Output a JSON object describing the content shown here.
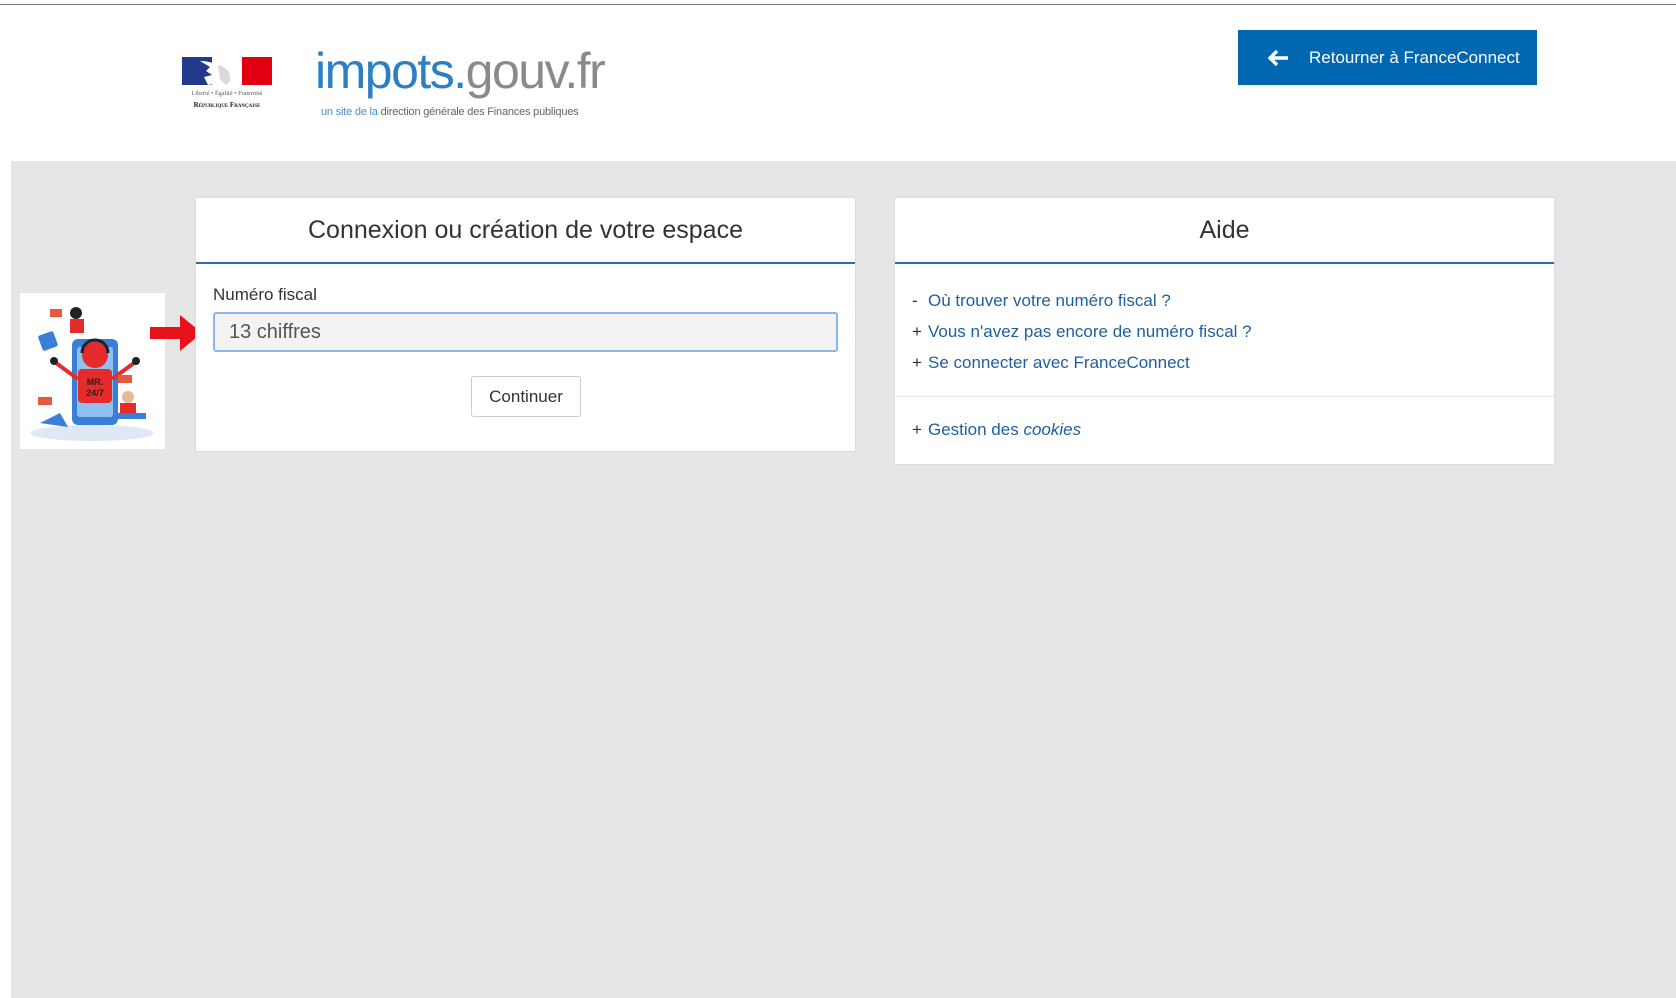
{
  "header": {
    "motto": "Liberté • Égalité • Fraternité",
    "republic": "République Française",
    "brand_part1": "impots.",
    "brand_part2": "gouv.fr",
    "subtitle_part1": "un site de la ",
    "subtitle_part2": "direction générale des Finances publiques",
    "return_button_label": "Retourner à FranceConnect",
    "colors": {
      "brand_blue": "#2d7ec3",
      "button_blue": "#0067b1",
      "red": "#e1000f"
    }
  },
  "mascot": {
    "badge_text_line1": "MR.",
    "badge_text_line2": "24/7"
  },
  "login_panel": {
    "title": "Connexion ou création de votre espace",
    "field_label": "Numéro fiscal",
    "field_placeholder": "13 chiffres",
    "field_value": "",
    "continue_label": "Continuer"
  },
  "help_panel": {
    "title": "Aide",
    "items": [
      {
        "sign": "-",
        "label": "Où trouver votre numéro fiscal ?"
      },
      {
        "sign": "+",
        "label": "Vous n'avez pas encore de numéro fiscal ?"
      },
      {
        "sign": "+",
        "label": "Se connecter avec FranceConnect"
      }
    ],
    "cookies": {
      "sign": "+",
      "label_prefix": "Gestion des ",
      "label_italic": "cookies"
    }
  },
  "icons": [
    "marianne-logo-icon",
    "arrow-left-icon",
    "mascot-illustration",
    "red-arrow-icon"
  ]
}
